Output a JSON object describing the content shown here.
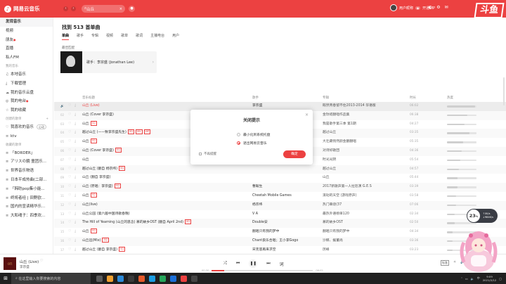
{
  "app": {
    "logo_text": "网易云音乐"
  },
  "header": {
    "search_value": "山丘",
    "user_name": "用户昵称",
    "vip_label": "开通VIP",
    "watermark": "斗鱼"
  },
  "sidebar": {
    "items_top": [
      "发现音乐",
      "视频",
      "朋友",
      "直播",
      "私人FM"
    ],
    "my_music_label": "我的音乐",
    "my_items": [
      "本地音乐",
      "下载管理",
      "我的音乐云盘",
      "我的电台",
      "我的收藏"
    ],
    "created_label": "创建的歌单",
    "created_items": [
      {
        "label": "我喜欢的音乐",
        "tag": "心动"
      },
      {
        "label": "ktv"
      }
    ],
    "collected_label": "收藏的歌单",
    "collected_items": [
      "「BORDER」",
      "アリスの鏡 童团乐...",
      "世界音乐物语",
      "日本平成热曲(二部...",
      "「韩昉pop集小能...",
      "终将者经 | 田野欧...",
      "国内的宣读精华乐...",
      "大和魂子：四季欢..."
    ]
  },
  "main": {
    "result_title": "找到 513 首单曲",
    "tabs": [
      "单曲",
      "歌手",
      "专辑",
      "视频",
      "歌单",
      "歌词",
      "主播电台",
      "用户"
    ],
    "best_label": "最佳匹配",
    "best_artist": "歌手：李宗盛 (Jonathan Lee)",
    "columns": {
      "title": "音乐标题",
      "artist": "歌手",
      "album": "专辑",
      "time": "时长",
      "hot": "热度"
    }
  },
  "songs": [
    {
      "num": "",
      "title": "山丘 (Live)",
      "badges": [],
      "artist": "李宗盛",
      "album": "既然青春留不住2013-2014 华语版",
      "time": "06:02",
      "hot": 0.95,
      "playing": true
    },
    {
      "num": "02",
      "title": "山丘 (Cover 李宗盛)",
      "badges": [],
      "artist": "金玟岐",
      "album": "金玟岐翻唱作品集",
      "time": "06:38",
      "hot": 0.7
    },
    {
      "num": "03",
      "title": "山丘",
      "badges": [
        "SQ"
      ],
      "artist": "李宗盛",
      "album": "我是歌手第三季 第1期",
      "time": "04:27",
      "hot": 0.6
    },
    {
      "num": "04",
      "title": "越过山丘 (——致李宗盛先生)",
      "badges": [
        "SQ",
        "MV",
        "VIP"
      ],
      "artist": "杨宗纬",
      "album": "越过山丘",
      "time": "03:35",
      "hot": 0.75
    },
    {
      "num": "05",
      "title": "山丘",
      "badges": [
        "SQ"
      ],
      "artist": "李宗盛",
      "album": "大壮藏悄然颜金翻翻唱",
      "time": "05:35",
      "hot": 0.55
    },
    {
      "num": "06",
      "title": "山丘 (Cover 李宗盛)",
      "badges": [
        "SQ"
      ],
      "artist": "李宗盛",
      "album": "对诗好歌团",
      "time": "04:36",
      "hot": 0.5
    },
    {
      "num": "07",
      "title": "山丘",
      "badges": [],
      "artist": "",
      "album": "时光光阴",
      "time": "05:54",
      "hot": 0.45
    },
    {
      "num": "08",
      "title": "越过山丘 (翻自 杨宗纬)",
      "badges": [
        "SQ"
      ],
      "artist": "",
      "album": "越过山丘",
      "time": "04:57",
      "hot": 0.4
    },
    {
      "num": "09",
      "title": "山丘 (翻自 李宗盛)",
      "badges": [],
      "artist": "",
      "album": "山丘",
      "time": "05:44",
      "hot": 0.35
    },
    {
      "num": "10",
      "title": "山丘 (原唱：李宗盛)",
      "badges": [
        "SQ"
      ],
      "artist": "曹翰生",
      "album": "2017新歌声第一人拉巡演 G.E.S",
      "time": "03:39",
      "hot": 0.35
    },
    {
      "num": "11",
      "title": "山丘",
      "badges": [
        "SQ"
      ],
      "artist": "Cheetah Mobile Games",
      "album": "滚动的天空 (游戏原声)",
      "time": "03:58",
      "hot": 0.3
    },
    {
      "num": "12",
      "title": "山丘(live)",
      "badges": [],
      "artist": "杨宗纬",
      "album": "热门串烧(37",
      "time": "07:06",
      "hot": 0.3
    },
    {
      "num": "13",
      "title": "山丘公园 (第六届中国诗歌春晚)",
      "badges": [],
      "artist": "V A",
      "album": "最热外语榜单120",
      "time": "02:34",
      "hot": 0.25
    },
    {
      "num": "14",
      "title": "The Hill of Yearning (山丘的思念) 慕的故乡OST (翻自 April 2nd)",
      "badges": [
        "SQ"
      ],
      "artist": "Double安",
      "album": "慕的故乡OST",
      "time": "02:50",
      "hot": 0.25
    },
    {
      "num": "15",
      "title": "山丘",
      "badges": [
        "SQ"
      ],
      "artist": "翻唱只有我的梦中",
      "album": "翻唱只有我的梦中",
      "time": "04:34",
      "hot": 0.2
    },
    {
      "num": "16",
      "title": "山丘远(Mix)",
      "badges": [
        "SQ"
      ],
      "artist": "Chant良乐合唱；王小李Gogo",
      "album": "沙鲸、据董尚",
      "time": "03:36",
      "hot": 0.2
    },
    {
      "num": "17",
      "title": "越过山丘 (翻自 李宗盛)",
      "badges": [
        "SQ"
      ],
      "artist": "宋克思再来求空",
      "album": "厉峰",
      "time": "03:23",
      "hot": 0.18
    },
    {
      "num": "18",
      "title": "山丘",
      "badges": [],
      "artist": "晏晏",
      "album": "中国梦之声·下一站传奇 第十五期 李宗盛",
      "time": "02:14",
      "hot": 0.15
    },
    {
      "num": "19",
      "title": "山丘 (翻自 李宗盛)",
      "badges": [
        "SQ"
      ],
      "artist": "善",
      "album": "九",
      "time": "03:52",
      "hot": 0.12
    }
  ],
  "dialog": {
    "title": "关闭提示",
    "option_minimize": "最小化到系统托盘",
    "option_exit": "退出网易云音乐",
    "dont_remind": "不再提醒",
    "ok_label": "确定"
  },
  "player": {
    "title": "山丘 (Live)",
    "artist": "李宗盛",
    "cover_text": "山丘",
    "time_now": "00:30",
    "time_total": "06:02",
    "progress": 0.12,
    "quality": "标准"
  },
  "float_ball": {
    "value": "23",
    "unit": "%",
    "up": "↑0K/s",
    "down": "↓984K/s"
  },
  "taskbar": {
    "search_placeholder": "在这里输入你要搜索的内容",
    "time": "9:09",
    "date": "2021/2/12"
  }
}
